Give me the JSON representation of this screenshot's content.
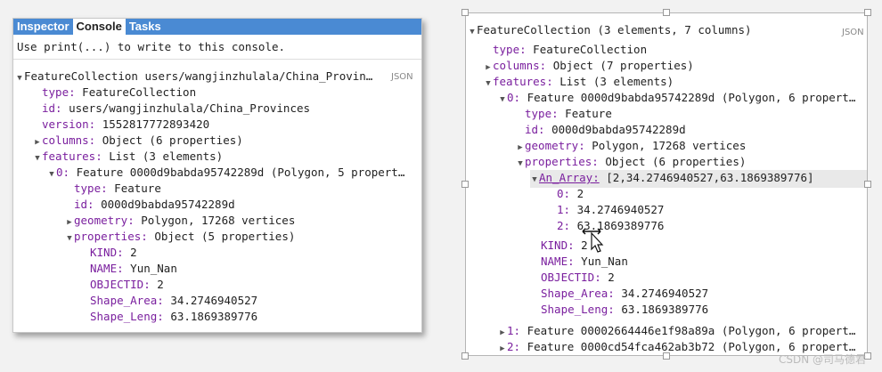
{
  "left_panel": {
    "tabs": [
      "Inspector",
      "Console",
      "Tasks"
    ],
    "hint": "Use print(...) to write to this console.",
    "json_tag": "JSON",
    "rows": [
      {
        "key": "FeatureCollection users/wangjinzhulala/China_Provin…",
        "val": ""
      },
      {
        "key": "type:",
        "val": "FeatureCollection"
      },
      {
        "key": "id:",
        "val": "users/wangjinzhulala/China_Provinces"
      },
      {
        "key": "version:",
        "val": "1552817772893420"
      },
      {
        "key": "columns:",
        "val": "Object (6 properties)"
      },
      {
        "key": "features:",
        "val": "List (3 elements)"
      },
      {
        "key": "0:",
        "val": "Feature 0000d9babda95742289d (Polygon, 5 propert…"
      },
      {
        "key": "type:",
        "val": "Feature"
      },
      {
        "key": "id:",
        "val": "0000d9babda95742289d"
      },
      {
        "key": "geometry:",
        "val": "Polygon, 17268 vertices"
      },
      {
        "key": "properties:",
        "val": "Object (5 properties)"
      },
      {
        "key": "KIND:",
        "val": "2"
      },
      {
        "key": "NAME:",
        "val": "Yun_Nan"
      },
      {
        "key": "OBJECTID:",
        "val": "2"
      },
      {
        "key": "Shape_Area:",
        "val": "34.2746940527"
      },
      {
        "key": "Shape_Leng:",
        "val": "63.1869389776"
      }
    ]
  },
  "right_panel": {
    "json_tag": "JSON",
    "rows": [
      {
        "key": "FeatureCollection (3 elements, 7 columns)",
        "val": ""
      },
      {
        "key": "type:",
        "val": "FeatureCollection"
      },
      {
        "key": "columns:",
        "val": "Object (7 properties)"
      },
      {
        "key": "features:",
        "val": "List (3 elements)"
      },
      {
        "key": "0:",
        "val": "Feature 0000d9babda95742289d (Polygon, 6 propert…"
      },
      {
        "key": "type:",
        "val": "Feature"
      },
      {
        "key": "id:",
        "val": "0000d9babda95742289d"
      },
      {
        "key": "geometry:",
        "val": "Polygon, 17268 vertices"
      },
      {
        "key": "properties:",
        "val": "Object (6 properties)"
      },
      {
        "key": "An_Array:",
        "val": "[2,34.2746940527,63.1869389776]"
      },
      {
        "key": "0:",
        "val": "2"
      },
      {
        "key": "1:",
        "val": "34.2746940527"
      },
      {
        "key": "2:",
        "val": "63.1869389776"
      },
      {
        "key": "KIND:",
        "val": "2"
      },
      {
        "key": "NAME:",
        "val": "Yun_Nan"
      },
      {
        "key": "OBJECTID:",
        "val": "2"
      },
      {
        "key": "Shape_Area:",
        "val": "34.2746940527"
      },
      {
        "key": "Shape_Leng:",
        "val": "63.1869389776"
      },
      {
        "key": "1:",
        "val": "Feature 00002664446e1f98a89a (Polygon, 6 propert…"
      },
      {
        "key": "2:",
        "val": "Feature 0000cd54fca462ab3b72 (Polygon, 6 propert…"
      }
    ]
  },
  "watermark": "CSDN @司马德君",
  "colors": {
    "tab_bar": "#4a8ad3",
    "key": "#7a1f9e"
  }
}
